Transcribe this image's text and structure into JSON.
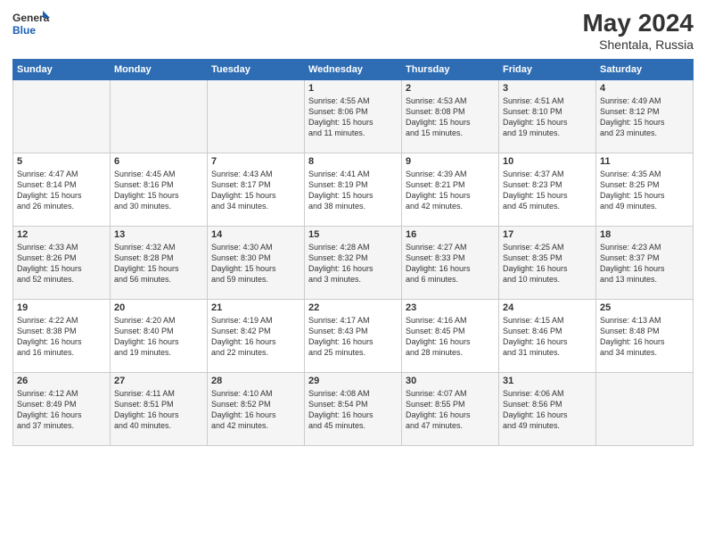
{
  "logo": {
    "line1": "General",
    "line2": "Blue"
  },
  "title": "May 2024",
  "subtitle": "Shentala, Russia",
  "days_header": [
    "Sunday",
    "Monday",
    "Tuesday",
    "Wednesday",
    "Thursday",
    "Friday",
    "Saturday"
  ],
  "weeks": [
    [
      {
        "day": "",
        "info": ""
      },
      {
        "day": "",
        "info": ""
      },
      {
        "day": "",
        "info": ""
      },
      {
        "day": "1",
        "info": "Sunrise: 4:55 AM\nSunset: 8:06 PM\nDaylight: 15 hours\nand 11 minutes."
      },
      {
        "day": "2",
        "info": "Sunrise: 4:53 AM\nSunset: 8:08 PM\nDaylight: 15 hours\nand 15 minutes."
      },
      {
        "day": "3",
        "info": "Sunrise: 4:51 AM\nSunset: 8:10 PM\nDaylight: 15 hours\nand 19 minutes."
      },
      {
        "day": "4",
        "info": "Sunrise: 4:49 AM\nSunset: 8:12 PM\nDaylight: 15 hours\nand 23 minutes."
      }
    ],
    [
      {
        "day": "5",
        "info": "Sunrise: 4:47 AM\nSunset: 8:14 PM\nDaylight: 15 hours\nand 26 minutes."
      },
      {
        "day": "6",
        "info": "Sunrise: 4:45 AM\nSunset: 8:16 PM\nDaylight: 15 hours\nand 30 minutes."
      },
      {
        "day": "7",
        "info": "Sunrise: 4:43 AM\nSunset: 8:17 PM\nDaylight: 15 hours\nand 34 minutes."
      },
      {
        "day": "8",
        "info": "Sunrise: 4:41 AM\nSunset: 8:19 PM\nDaylight: 15 hours\nand 38 minutes."
      },
      {
        "day": "9",
        "info": "Sunrise: 4:39 AM\nSunset: 8:21 PM\nDaylight: 15 hours\nand 42 minutes."
      },
      {
        "day": "10",
        "info": "Sunrise: 4:37 AM\nSunset: 8:23 PM\nDaylight: 15 hours\nand 45 minutes."
      },
      {
        "day": "11",
        "info": "Sunrise: 4:35 AM\nSunset: 8:25 PM\nDaylight: 15 hours\nand 49 minutes."
      }
    ],
    [
      {
        "day": "12",
        "info": "Sunrise: 4:33 AM\nSunset: 8:26 PM\nDaylight: 15 hours\nand 52 minutes."
      },
      {
        "day": "13",
        "info": "Sunrise: 4:32 AM\nSunset: 8:28 PM\nDaylight: 15 hours\nand 56 minutes."
      },
      {
        "day": "14",
        "info": "Sunrise: 4:30 AM\nSunset: 8:30 PM\nDaylight: 15 hours\nand 59 minutes."
      },
      {
        "day": "15",
        "info": "Sunrise: 4:28 AM\nSunset: 8:32 PM\nDaylight: 16 hours\nand 3 minutes."
      },
      {
        "day": "16",
        "info": "Sunrise: 4:27 AM\nSunset: 8:33 PM\nDaylight: 16 hours\nand 6 minutes."
      },
      {
        "day": "17",
        "info": "Sunrise: 4:25 AM\nSunset: 8:35 PM\nDaylight: 16 hours\nand 10 minutes."
      },
      {
        "day": "18",
        "info": "Sunrise: 4:23 AM\nSunset: 8:37 PM\nDaylight: 16 hours\nand 13 minutes."
      }
    ],
    [
      {
        "day": "19",
        "info": "Sunrise: 4:22 AM\nSunset: 8:38 PM\nDaylight: 16 hours\nand 16 minutes."
      },
      {
        "day": "20",
        "info": "Sunrise: 4:20 AM\nSunset: 8:40 PM\nDaylight: 16 hours\nand 19 minutes."
      },
      {
        "day": "21",
        "info": "Sunrise: 4:19 AM\nSunset: 8:42 PM\nDaylight: 16 hours\nand 22 minutes."
      },
      {
        "day": "22",
        "info": "Sunrise: 4:17 AM\nSunset: 8:43 PM\nDaylight: 16 hours\nand 25 minutes."
      },
      {
        "day": "23",
        "info": "Sunrise: 4:16 AM\nSunset: 8:45 PM\nDaylight: 16 hours\nand 28 minutes."
      },
      {
        "day": "24",
        "info": "Sunrise: 4:15 AM\nSunset: 8:46 PM\nDaylight: 16 hours\nand 31 minutes."
      },
      {
        "day": "25",
        "info": "Sunrise: 4:13 AM\nSunset: 8:48 PM\nDaylight: 16 hours\nand 34 minutes."
      }
    ],
    [
      {
        "day": "26",
        "info": "Sunrise: 4:12 AM\nSunset: 8:49 PM\nDaylight: 16 hours\nand 37 minutes."
      },
      {
        "day": "27",
        "info": "Sunrise: 4:11 AM\nSunset: 8:51 PM\nDaylight: 16 hours\nand 40 minutes."
      },
      {
        "day": "28",
        "info": "Sunrise: 4:10 AM\nSunset: 8:52 PM\nDaylight: 16 hours\nand 42 minutes."
      },
      {
        "day": "29",
        "info": "Sunrise: 4:08 AM\nSunset: 8:54 PM\nDaylight: 16 hours\nand 45 minutes."
      },
      {
        "day": "30",
        "info": "Sunrise: 4:07 AM\nSunset: 8:55 PM\nDaylight: 16 hours\nand 47 minutes."
      },
      {
        "day": "31",
        "info": "Sunrise: 4:06 AM\nSunset: 8:56 PM\nDaylight: 16 hours\nand 49 minutes."
      },
      {
        "day": "",
        "info": ""
      }
    ]
  ]
}
